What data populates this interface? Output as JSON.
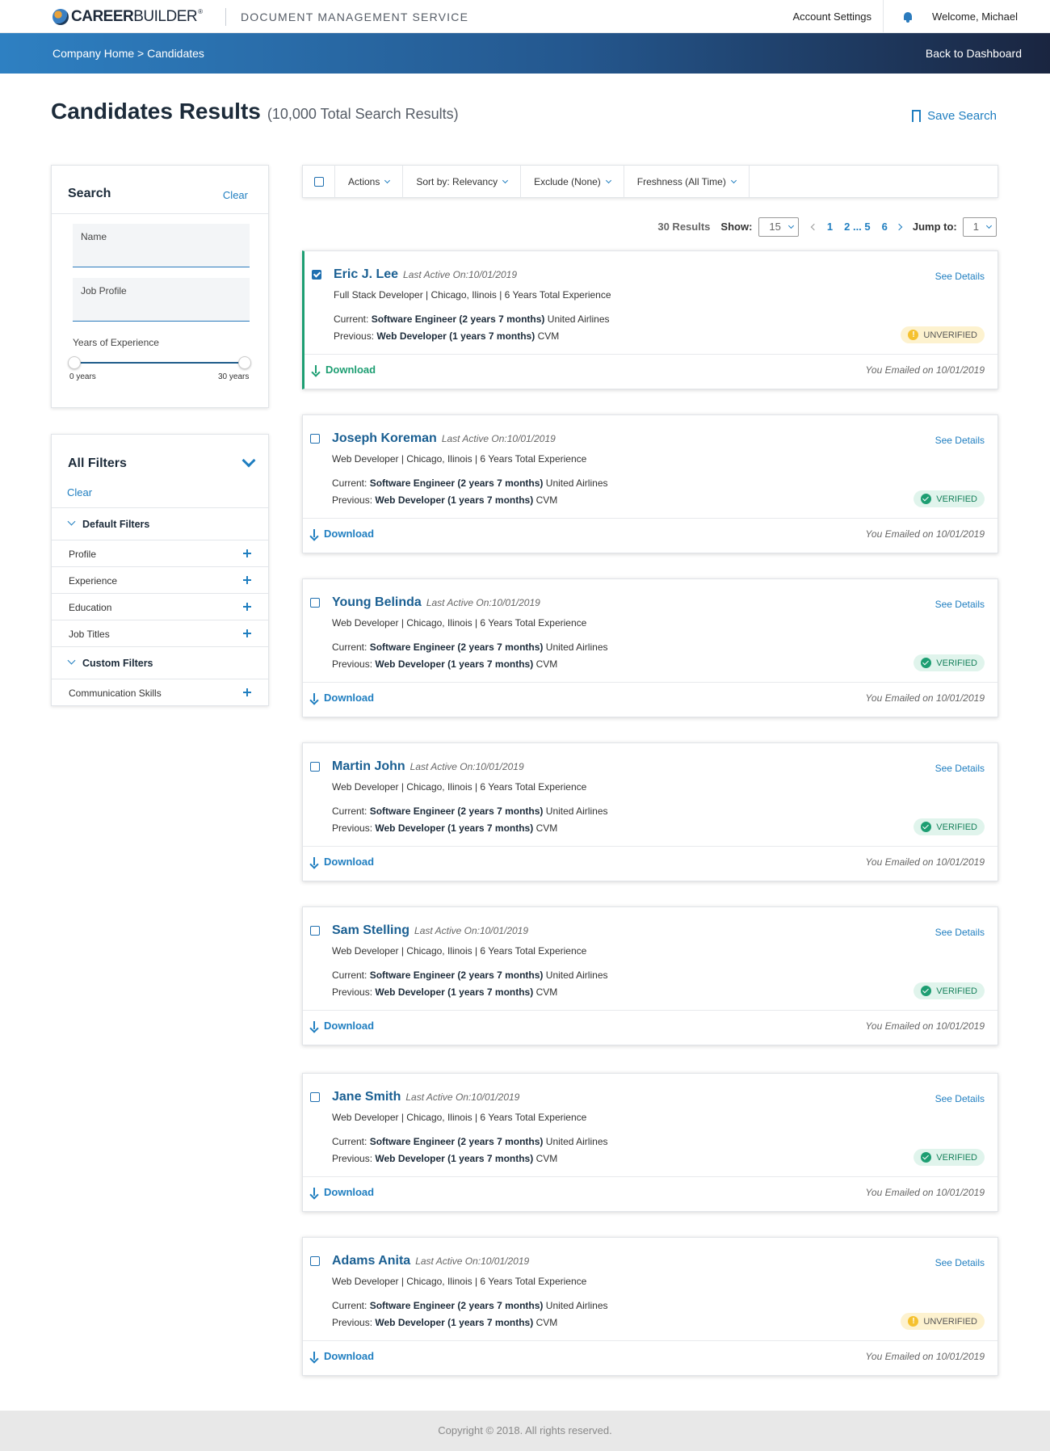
{
  "header": {
    "brand_bold": "CAREER",
    "brand_light": "BUILDER",
    "brand_mark": "®",
    "service": "DOCUMENT MANAGEMENT SERVICE",
    "account_settings": "Account Settings",
    "welcome": "Welcome, Michael",
    "bell_icon": "bell-icon"
  },
  "nav": {
    "breadcrumb": "Company Home > Candidates",
    "back": "Back to Dashboard",
    "gradient": [
      "#2e80c2",
      "#1a2540"
    ]
  },
  "page": {
    "title": "Candidates Results",
    "total": "(10,000 Total Search Results)",
    "save_search": "Save Search"
  },
  "search": {
    "title": "Search",
    "clear": "Clear",
    "name_label": "Name",
    "name_value": "",
    "job_label": "Job Profile",
    "job_value": "",
    "yoe_label": "Years of Experience",
    "min_label": "0 years",
    "max_label": "30 years",
    "range_min": 0,
    "range_max": 30
  },
  "filters": {
    "title": "All Filters",
    "clear": "Clear",
    "default_group": "Default Filters",
    "default_items": [
      "Profile",
      "Experience",
      "Education",
      "Job Titles"
    ],
    "custom_group": "Custom Filters",
    "custom_items": [
      "Communication Skills"
    ]
  },
  "toolbar": {
    "actions": "Actions",
    "sort": "Sort by: Relevancy",
    "exclude": "Exclude (None)",
    "freshness": "Freshness (All Time)"
  },
  "pager": {
    "results": "30 Results",
    "show_label": "Show:",
    "show_value": "15",
    "page1": "1",
    "range": "2 ... 5",
    "page6": "6",
    "jump_label": "Jump to:",
    "jump_value": "1"
  },
  "cards": [
    {
      "name": "Eric J. Lee",
      "active": "Last Active On:10/01/2019",
      "meta": "Full Stack Developer  |  Chicago,  Ilinois  |  6 Years Total Experience",
      "cur_label": "Current:",
      "cur_title": "Software Engineer (2 years 7 months)",
      "cur_co": "United Airlines",
      "prev_label": "Previous:",
      "prev_title": "Web Developer (1 years 7 months)",
      "prev_co": "CVM",
      "details": "See Details",
      "download": "Download",
      "emailed": "You Emailed on 10/01/2019",
      "status": "UNVERIFIED",
      "checked": true
    },
    {
      "name": "Joseph Koreman",
      "active": "Last Active On:10/01/2019",
      "meta": "Web Developer  |  Chicago,  Ilinois  |  6 Years Total Experience",
      "cur_label": "Current:",
      "cur_title": "Software Engineer (2 years 7 months)",
      "cur_co": "United Airlines",
      "prev_label": "Previous:",
      "prev_title": "Web Developer (1 years 7 months)",
      "prev_co": "CVM",
      "details": "See Details",
      "download": "Download",
      "emailed": "You Emailed on 10/01/2019",
      "status": "VERIFIED",
      "checked": false
    },
    {
      "name": "Young Belinda",
      "active": "Last Active On:10/01/2019",
      "meta": "Web Developer  |  Chicago,  Ilinois  |  6 Years Total Experience",
      "cur_label": "Current:",
      "cur_title": "Software Engineer (2 years 7 months)",
      "cur_co": "United Airlines",
      "prev_label": "Previous:",
      "prev_title": "Web Developer (1 years 7 months)",
      "prev_co": "CVM",
      "details": "See Details",
      "download": "Download",
      "emailed": "You Emailed on 10/01/2019",
      "status": "VERIFIED",
      "checked": false
    },
    {
      "name": "Martin John",
      "active": "Last Active On:10/01/2019",
      "meta": "Web Developer  |  Chicago,  Ilinois  |  6 Years Total Experience",
      "cur_label": "Current:",
      "cur_title": "Software Engineer (2 years 7 months)",
      "cur_co": "United Airlines",
      "prev_label": "Previous:",
      "prev_title": "Web Developer (1 years 7 months)",
      "prev_co": "CVM",
      "details": "See Details",
      "download": "Download",
      "emailed": "You Emailed on 10/01/2019",
      "status": "VERIFIED",
      "checked": false
    },
    {
      "name": "Sam Stelling",
      "active": "Last Active On:10/01/2019",
      "meta": "Web Developer  |  Chicago,  Ilinois  |  6 Years Total Experience",
      "cur_label": "Current:",
      "cur_title": "Software Engineer (2 years 7 months)",
      "cur_co": "United Airlines",
      "prev_label": "Previous:",
      "prev_title": "Web Developer (1 years 7 months)",
      "prev_co": "CVM",
      "details": "See Details",
      "download": "Download",
      "emailed": "You Emailed on 10/01/2019",
      "status": "VERIFIED",
      "checked": false
    },
    {
      "name": "Jane Smith",
      "active": "Last Active On:10/01/2019",
      "meta": "Web Developer  |  Chicago,  Ilinois  |  6 Years Total Experience",
      "cur_label": "Current:",
      "cur_title": "Software Engineer (2 years 7 months)",
      "cur_co": "United Airlines",
      "prev_label": "Previous:",
      "prev_title": "Web Developer (1 years 7 months)",
      "prev_co": "CVM",
      "details": "See Details",
      "download": "Download",
      "emailed": "You Emailed on 10/01/2019",
      "status": "VERIFIED",
      "checked": false
    },
    {
      "name": "Adams Anita",
      "active": "Last Active On:10/01/2019",
      "meta": "Web Developer  |  Chicago,  Ilinois  |  6 Years Total Experience",
      "cur_label": "Current:",
      "cur_title": "Software Engineer (2 years 7 months)",
      "cur_co": "United Airlines",
      "prev_label": "Previous:",
      "prev_title": "Web Developer (1 years 7 months)",
      "prev_co": "CVM",
      "details": "See Details",
      "download": "Download",
      "emailed": "You Emailed on 10/01/2019",
      "status": "UNVERIFIED",
      "checked": false
    }
  ],
  "footer": {
    "copyright": "Copyright © 2018. All rights reserved."
  },
  "colors": {
    "accent": "#1f7ec0",
    "selected": "#1d9e72",
    "verified_bg": "#e0f4ec",
    "unverified_bg": "#fdf2cf"
  }
}
